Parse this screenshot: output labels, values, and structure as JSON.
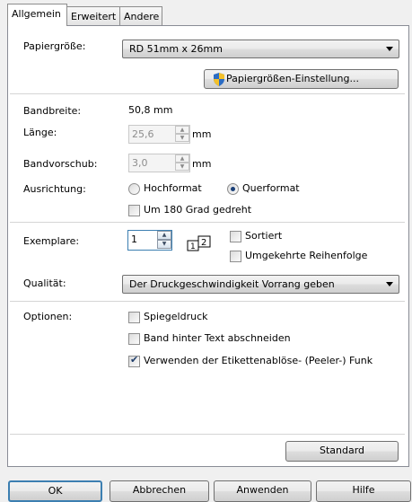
{
  "tabs": [
    {
      "label": "Allgemein",
      "active": true
    },
    {
      "label": "Erweitert",
      "active": false
    },
    {
      "label": "Andere",
      "active": false
    }
  ],
  "paper": {
    "label": "Papiergröße:",
    "value": "RD 51mm x 26mm",
    "settings_button": "Papiergrößen-Einstellung..."
  },
  "tape_width": {
    "label": "Bandbreite:",
    "value": "50,8 mm"
  },
  "length": {
    "label": "Länge:",
    "value": "25,6",
    "unit": "mm",
    "enabled": false
  },
  "feed": {
    "label": "Bandvorschub:",
    "value": "3,0",
    "unit": "mm",
    "enabled": false
  },
  "orientation": {
    "label": "Ausrichtung:",
    "portrait": "Hochformat",
    "landscape": "Querformat",
    "selected": "landscape",
    "rotate_label": "Um 180 Grad gedreht",
    "rotate_checked": false
  },
  "copies": {
    "label": "Exemplare:",
    "value": "1",
    "collate_label": "Sortiert",
    "collate_checked": false,
    "reverse_label": "Umgekehrte Reihenfolge",
    "reverse_checked": false,
    "collate_icon": "collate-1-2-icon"
  },
  "quality": {
    "label": "Qualität:",
    "value": "Der Druckgeschwindigkeit Vorrang geben"
  },
  "options": {
    "label": "Optionen:",
    "items": [
      {
        "label": "Spiegeldruck",
        "checked": false
      },
      {
        "label": "Band hinter Text abschneiden",
        "checked": false
      },
      {
        "label": "Verwenden der Etikettenablöse- (Peeler-) Funk",
        "checked": true
      }
    ]
  },
  "standard_button": "Standard",
  "dialog_buttons": {
    "ok": "OK",
    "cancel": "Abbrechen",
    "apply": "Anwenden",
    "help": "Hilfe"
  },
  "colors": {
    "panel_border": "#898c95",
    "focus_border": "#3c7fb1",
    "shield_blue": "#2b6cc4",
    "shield_yellow": "#f4c12a"
  }
}
